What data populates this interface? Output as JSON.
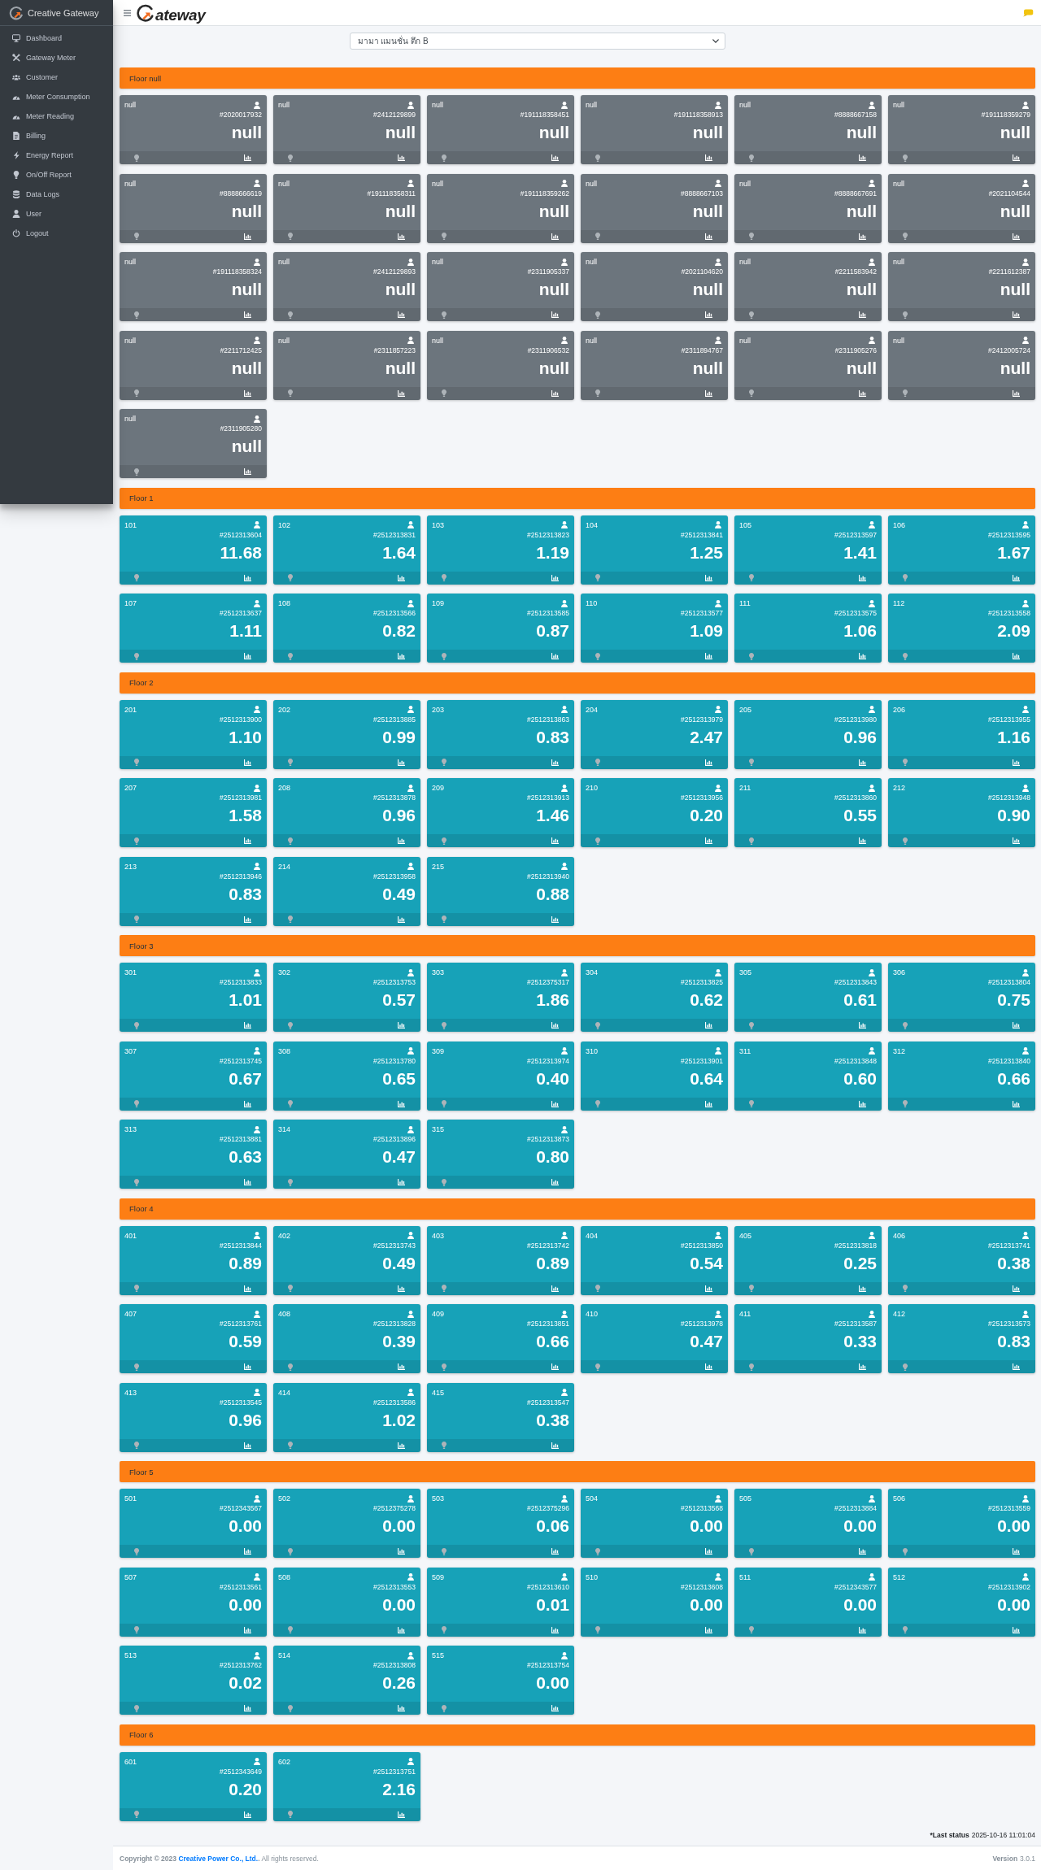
{
  "sidebar": {
    "brand": "Creative Gateway",
    "items": [
      {
        "label": "Dashboard",
        "selected": false
      },
      {
        "label": "Gateway Meter",
        "selected": false
      },
      {
        "label": "Customer",
        "selected": false
      },
      {
        "label": "Meter Consumption",
        "selected": false
      },
      {
        "label": "Meter Reading",
        "selected": false
      },
      {
        "label": "Billing",
        "selected": false
      },
      {
        "label": "Energy Report",
        "selected": false
      },
      {
        "label": "On/Off Report",
        "selected": false
      },
      {
        "label": "Data Logs",
        "selected": false
      },
      {
        "label": "User",
        "selected": false
      },
      {
        "label": "Logout",
        "selected": false
      }
    ]
  },
  "header": {
    "logo_text": "ateway"
  },
  "building_select": {
    "value": "มามา แมนชั่น ตึก B"
  },
  "floors": [
    {
      "title": "Floor null",
      "meters": [
        {
          "room": "null",
          "meter_id": "#2020017932",
          "reading": "null",
          "color": "#6c757d"
        },
        {
          "room": "null",
          "meter_id": "#2412129899",
          "reading": "null",
          "color": "#6c757d"
        },
        {
          "room": "null",
          "meter_id": "#191118358451",
          "reading": "null",
          "color": "#6c757d"
        },
        {
          "room": "null",
          "meter_id": "#191118358913",
          "reading": "null",
          "color": "#6c757d"
        },
        {
          "room": "null",
          "meter_id": "#8888667158",
          "reading": "null",
          "color": "#6c757d"
        },
        {
          "room": "null",
          "meter_id": "#191118359279",
          "reading": "null",
          "color": "#6c757d"
        },
        {
          "room": "null",
          "meter_id": "#8888666619",
          "reading": "null",
          "color": "#6c757d"
        },
        {
          "room": "null",
          "meter_id": "#191118358311",
          "reading": "null",
          "color": "#6c757d"
        },
        {
          "room": "null",
          "meter_id": "#191118359262",
          "reading": "null",
          "color": "#6c757d"
        },
        {
          "room": "null",
          "meter_id": "#8888667103",
          "reading": "null",
          "color": "#6c757d"
        },
        {
          "room": "null",
          "meter_id": "#8888667691",
          "reading": "null",
          "color": "#6c757d"
        },
        {
          "room": "null",
          "meter_id": "#2021104544",
          "reading": "null",
          "color": "#6c757d"
        },
        {
          "room": "null",
          "meter_id": "#191118358324",
          "reading": "null",
          "color": "#6c757d"
        },
        {
          "room": "null",
          "meter_id": "#2412129893",
          "reading": "null",
          "color": "#6c757d"
        },
        {
          "room": "null",
          "meter_id": "#2311905337",
          "reading": "null",
          "color": "#6c757d"
        },
        {
          "room": "null",
          "meter_id": "#2021104620",
          "reading": "null",
          "color": "#6c757d"
        },
        {
          "room": "null",
          "meter_id": "#2211583942",
          "reading": "null",
          "color": "#6c757d"
        },
        {
          "room": "null",
          "meter_id": "#2211612387",
          "reading": "null",
          "color": "#6c757d"
        },
        {
          "room": "null",
          "meter_id": "#2211712425",
          "reading": "null",
          "color": "#6c757d"
        },
        {
          "room": "null",
          "meter_id": "#2311857223",
          "reading": "null",
          "color": "#6c757d"
        },
        {
          "room": "null",
          "meter_id": "#2311906532",
          "reading": "null",
          "color": "#6c757d"
        },
        {
          "room": "null",
          "meter_id": "#2311894767",
          "reading": "null",
          "color": "#6c757d"
        },
        {
          "room": "null",
          "meter_id": "#2311905276",
          "reading": "null",
          "color": "#6c757d"
        },
        {
          "room": "null",
          "meter_id": "#2412005724",
          "reading": "null",
          "color": "#6c757d"
        },
        {
          "room": "null",
          "meter_id": "#2311905280",
          "reading": "null",
          "color": "#6c757d"
        }
      ]
    },
    {
      "title": "Floor 1",
      "meters": [
        {
          "room": "101",
          "meter_id": "#2512313604",
          "reading": "11.68",
          "color": "#17a2b8"
        },
        {
          "room": "102",
          "meter_id": "#2512313831",
          "reading": "1.64",
          "color": "#17a2b8"
        },
        {
          "room": "103",
          "meter_id": "#2512313823",
          "reading": "1.19",
          "color": "#17a2b8"
        },
        {
          "room": "104",
          "meter_id": "#2512313841",
          "reading": "1.25",
          "color": "#17a2b8"
        },
        {
          "room": "105",
          "meter_id": "#2512313597",
          "reading": "1.41",
          "color": "#17a2b8"
        },
        {
          "room": "106",
          "meter_id": "#2512313595",
          "reading": "1.67",
          "color": "#17a2b8"
        },
        {
          "room": "107",
          "meter_id": "#2512313637",
          "reading": "1.11",
          "color": "#17a2b8"
        },
        {
          "room": "108",
          "meter_id": "#2512313566",
          "reading": "0.82",
          "color": "#17a2b8"
        },
        {
          "room": "109",
          "meter_id": "#2512313585",
          "reading": "0.87",
          "color": "#17a2b8"
        },
        {
          "room": "110",
          "meter_id": "#2512313577",
          "reading": "1.09",
          "color": "#17a2b8"
        },
        {
          "room": "111",
          "meter_id": "#2512313575",
          "reading": "1.06",
          "color": "#17a2b8"
        },
        {
          "room": "112",
          "meter_id": "#2512313558",
          "reading": "2.09",
          "color": "#17a2b8"
        }
      ]
    },
    {
      "title": "Floor 2",
      "meters": [
        {
          "room": "201",
          "meter_id": "#2512313900",
          "reading": "1.10",
          "color": "#17a2b8"
        },
        {
          "room": "202",
          "meter_id": "#2512313885",
          "reading": "0.99",
          "color": "#17a2b8"
        },
        {
          "room": "203",
          "meter_id": "#2512313863",
          "reading": "0.83",
          "color": "#17a2b8"
        },
        {
          "room": "204",
          "meter_id": "#2512313979",
          "reading": "2.47",
          "color": "#17a2b8"
        },
        {
          "room": "205",
          "meter_id": "#2512313980",
          "reading": "0.96",
          "color": "#17a2b8"
        },
        {
          "room": "206",
          "meter_id": "#2512313955",
          "reading": "1.16",
          "color": "#17a2b8"
        },
        {
          "room": "207",
          "meter_id": "#2512313981",
          "reading": "1.58",
          "color": "#17a2b8"
        },
        {
          "room": "208",
          "meter_id": "#2512313878",
          "reading": "0.96",
          "color": "#17a2b8"
        },
        {
          "room": "209",
          "meter_id": "#2512313913",
          "reading": "1.46",
          "color": "#17a2b8"
        },
        {
          "room": "210",
          "meter_id": "#2512313956",
          "reading": "0.20",
          "color": "#17a2b8"
        },
        {
          "room": "211",
          "meter_id": "#2512313860",
          "reading": "0.55",
          "color": "#17a2b8"
        },
        {
          "room": "212",
          "meter_id": "#2512313948",
          "reading": "0.90",
          "color": "#17a2b8"
        },
        {
          "room": "213",
          "meter_id": "#2512313946",
          "reading": "0.83",
          "color": "#17a2b8"
        },
        {
          "room": "214",
          "meter_id": "#2512313958",
          "reading": "0.49",
          "color": "#17a2b8"
        },
        {
          "room": "215",
          "meter_id": "#2512313940",
          "reading": "0.88",
          "color": "#17a2b8"
        }
      ]
    },
    {
      "title": "Floor 3",
      "meters": [
        {
          "room": "301",
          "meter_id": "#2512313833",
          "reading": "1.01",
          "color": "#17a2b8"
        },
        {
          "room": "302",
          "meter_id": "#2512313753",
          "reading": "0.57",
          "color": "#17a2b8"
        },
        {
          "room": "303",
          "meter_id": "#2512375317",
          "reading": "1.86",
          "color": "#17a2b8"
        },
        {
          "room": "304",
          "meter_id": "#2512313825",
          "reading": "0.62",
          "color": "#17a2b8"
        },
        {
          "room": "305",
          "meter_id": "#2512313843",
          "reading": "0.61",
          "color": "#17a2b8"
        },
        {
          "room": "306",
          "meter_id": "#2512313804",
          "reading": "0.75",
          "color": "#17a2b8"
        },
        {
          "room": "307",
          "meter_id": "#2512313745",
          "reading": "0.67",
          "color": "#17a2b8"
        },
        {
          "room": "308",
          "meter_id": "#2512313780",
          "reading": "0.65",
          "color": "#17a2b8"
        },
        {
          "room": "309",
          "meter_id": "#2512313974",
          "reading": "0.40",
          "color": "#17a2b8"
        },
        {
          "room": "310",
          "meter_id": "#2512313901",
          "reading": "0.64",
          "color": "#17a2b8"
        },
        {
          "room": "311",
          "meter_id": "#2512313848",
          "reading": "0.60",
          "color": "#17a2b8"
        },
        {
          "room": "312",
          "meter_id": "#2512313840",
          "reading": "0.66",
          "color": "#17a2b8"
        },
        {
          "room": "313",
          "meter_id": "#2512313881",
          "reading": "0.63",
          "color": "#17a2b8"
        },
        {
          "room": "314",
          "meter_id": "#2512313896",
          "reading": "0.47",
          "color": "#17a2b8"
        },
        {
          "room": "315",
          "meter_id": "#2512313873",
          "reading": "0.80",
          "color": "#17a2b8"
        }
      ]
    },
    {
      "title": "Floor 4",
      "meters": [
        {
          "room": "401",
          "meter_id": "#2512313844",
          "reading": "0.89",
          "color": "#17a2b8"
        },
        {
          "room": "402",
          "meter_id": "#2512313743",
          "reading": "0.49",
          "color": "#17a2b8"
        },
        {
          "room": "403",
          "meter_id": "#2512313742",
          "reading": "0.89",
          "color": "#17a2b8"
        },
        {
          "room": "404",
          "meter_id": "#2512313850",
          "reading": "0.54",
          "color": "#17a2b8"
        },
        {
          "room": "405",
          "meter_id": "#2512313818",
          "reading": "0.25",
          "color": "#17a2b8"
        },
        {
          "room": "406",
          "meter_id": "#2512313741",
          "reading": "0.38",
          "color": "#17a2b8"
        },
        {
          "room": "407",
          "meter_id": "#2512313761",
          "reading": "0.59",
          "color": "#17a2b8"
        },
        {
          "room": "408",
          "meter_id": "#2512313828",
          "reading": "0.39",
          "color": "#17a2b8"
        },
        {
          "room": "409",
          "meter_id": "#2512313851",
          "reading": "0.66",
          "color": "#17a2b8"
        },
        {
          "room": "410",
          "meter_id": "#2512313978",
          "reading": "0.47",
          "color": "#17a2b8"
        },
        {
          "room": "411",
          "meter_id": "#2512313587",
          "reading": "0.33",
          "color": "#17a2b8"
        },
        {
          "room": "412",
          "meter_id": "#2512313573",
          "reading": "0.83",
          "color": "#17a2b8"
        },
        {
          "room": "413",
          "meter_id": "#2512313545",
          "reading": "0.96",
          "color": "#17a2b8"
        },
        {
          "room": "414",
          "meter_id": "#2512313586",
          "reading": "1.02",
          "color": "#17a2b8"
        },
        {
          "room": "415",
          "meter_id": "#2512313547",
          "reading": "0.38",
          "color": "#17a2b8"
        }
      ]
    },
    {
      "title": "Floor 5",
      "meters": [
        {
          "room": "501",
          "meter_id": "#2512343567",
          "reading": "0.00",
          "color": "#17a2b8"
        },
        {
          "room": "502",
          "meter_id": "#2512375278",
          "reading": "0.00",
          "color": "#17a2b8"
        },
        {
          "room": "503",
          "meter_id": "#2512375296",
          "reading": "0.06",
          "color": "#17a2b8"
        },
        {
          "room": "504",
          "meter_id": "#2512313568",
          "reading": "0.00",
          "color": "#17a2b8"
        },
        {
          "room": "505",
          "meter_id": "#2512313884",
          "reading": "0.00",
          "color": "#17a2b8"
        },
        {
          "room": "506",
          "meter_id": "#2512313559",
          "reading": "0.00",
          "color": "#17a2b8"
        },
        {
          "room": "507",
          "meter_id": "#2512313561",
          "reading": "0.00",
          "color": "#17a2b8"
        },
        {
          "room": "508",
          "meter_id": "#2512313553",
          "reading": "0.00",
          "color": "#17a2b8"
        },
        {
          "room": "509",
          "meter_id": "#2512313610",
          "reading": "0.01",
          "color": "#17a2b8"
        },
        {
          "room": "510",
          "meter_id": "#2512313608",
          "reading": "0.00",
          "color": "#17a2b8"
        },
        {
          "room": "511",
          "meter_id": "#2512343577",
          "reading": "0.00",
          "color": "#17a2b8"
        },
        {
          "room": "512",
          "meter_id": "#2512313902",
          "reading": "0.00",
          "color": "#17a2b8"
        },
        {
          "room": "513",
          "meter_id": "#2512313762",
          "reading": "0.02",
          "color": "#17a2b8"
        },
        {
          "room": "514",
          "meter_id": "#2512313808",
          "reading": "0.26",
          "color": "#17a2b8"
        },
        {
          "room": "515",
          "meter_id": "#2512313754",
          "reading": "0.00",
          "color": "#17a2b8"
        }
      ]
    },
    {
      "title": "Floor 6",
      "meters": [
        {
          "room": "601",
          "meter_id": "#2512343649",
          "reading": "0.20",
          "color": "#17a2b8"
        },
        {
          "room": "602",
          "meter_id": "#2512313751",
          "reading": "2.16",
          "color": "#17a2b8"
        }
      ]
    }
  ],
  "last_status": {
    "label": "*Last status",
    "time": "2025-10-16 11:01:04"
  },
  "footer": {
    "copyright_before": "**Copyright © 2023** ",
    "company": "Creative Power Co., Ltd.",
    "copyright_after": "**.** All rights reserved.",
    "version_label": "Version",
    "version": "3.0.1"
  }
}
